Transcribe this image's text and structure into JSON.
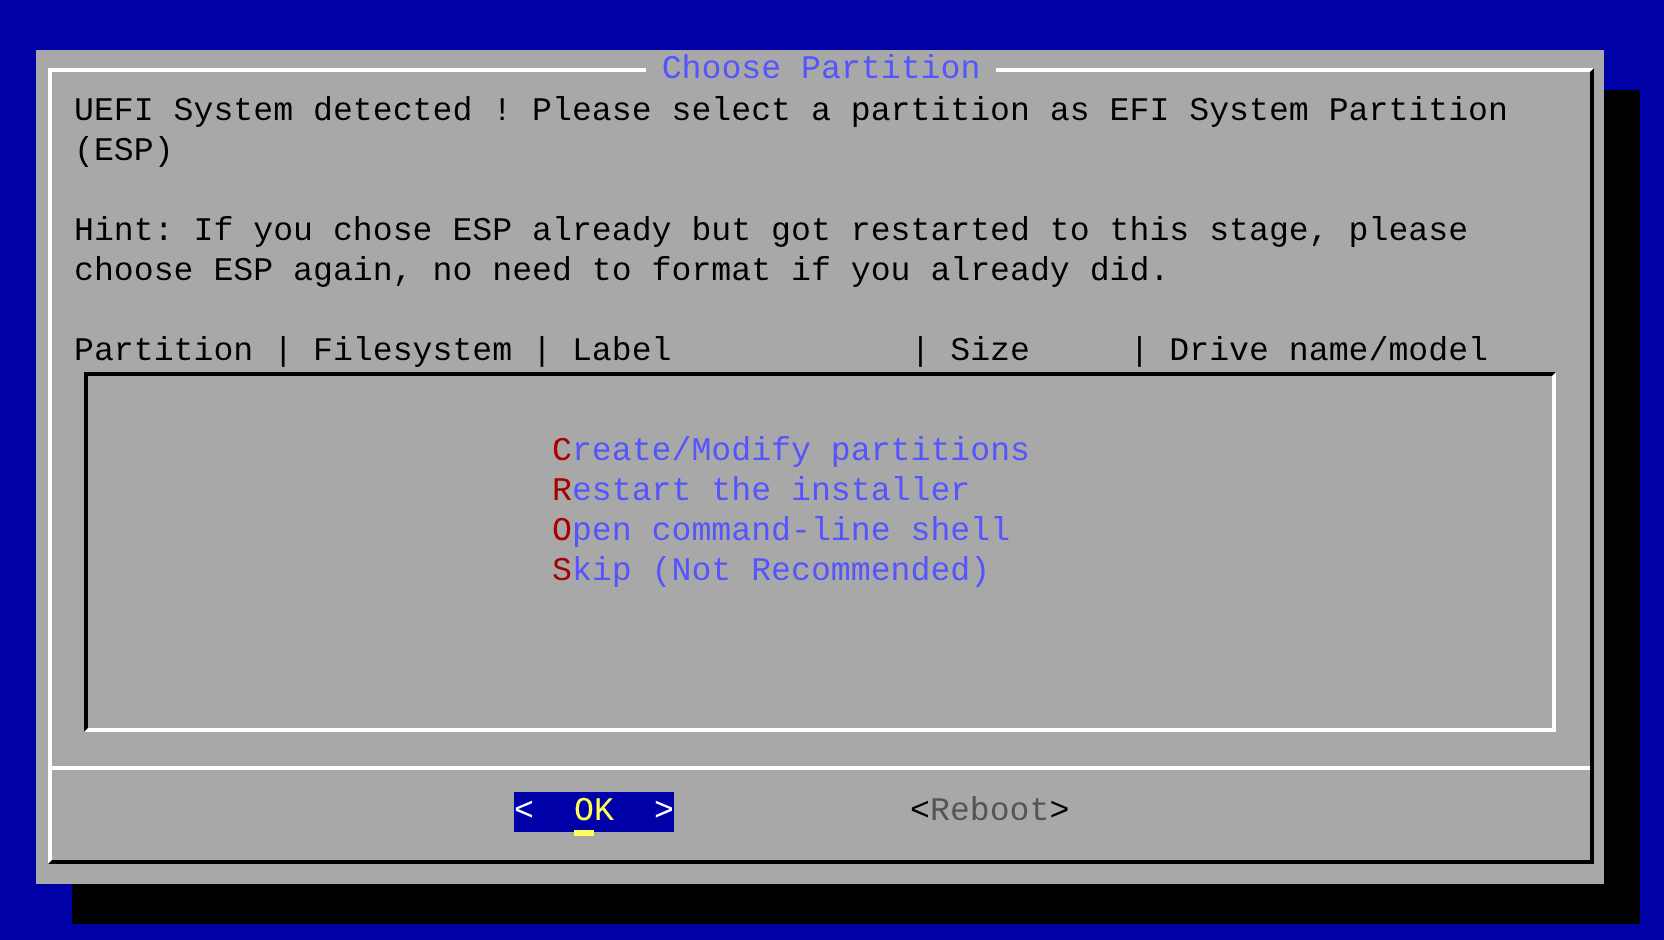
{
  "dialog": {
    "title": "Choose Partition",
    "paragraphs": [
      "UEFI System detected ! Please select a partition as EFI System Partition (ESP)",
      "Hint: If you chose ESP already but got restarted to this stage, please choose ESP again, no need to format if you already did."
    ],
    "header": "Partition | Filesystem | Label            | Size     | Drive name/model",
    "menu": [
      {
        "label": "Create/Modify partitions",
        "selected": false
      },
      {
        "label": "Restart the installer",
        "selected": false
      },
      {
        "label": "Open command-line shell",
        "selected": false
      },
      {
        "label": "Skip (Not Recommended)",
        "selected": false
      }
    ],
    "buttons": [
      {
        "left": "<",
        "label": "OK",
        "right": ">",
        "selected": true
      },
      {
        "left": "<",
        "label": "Reboot",
        "right": ">",
        "selected": false
      }
    ]
  }
}
